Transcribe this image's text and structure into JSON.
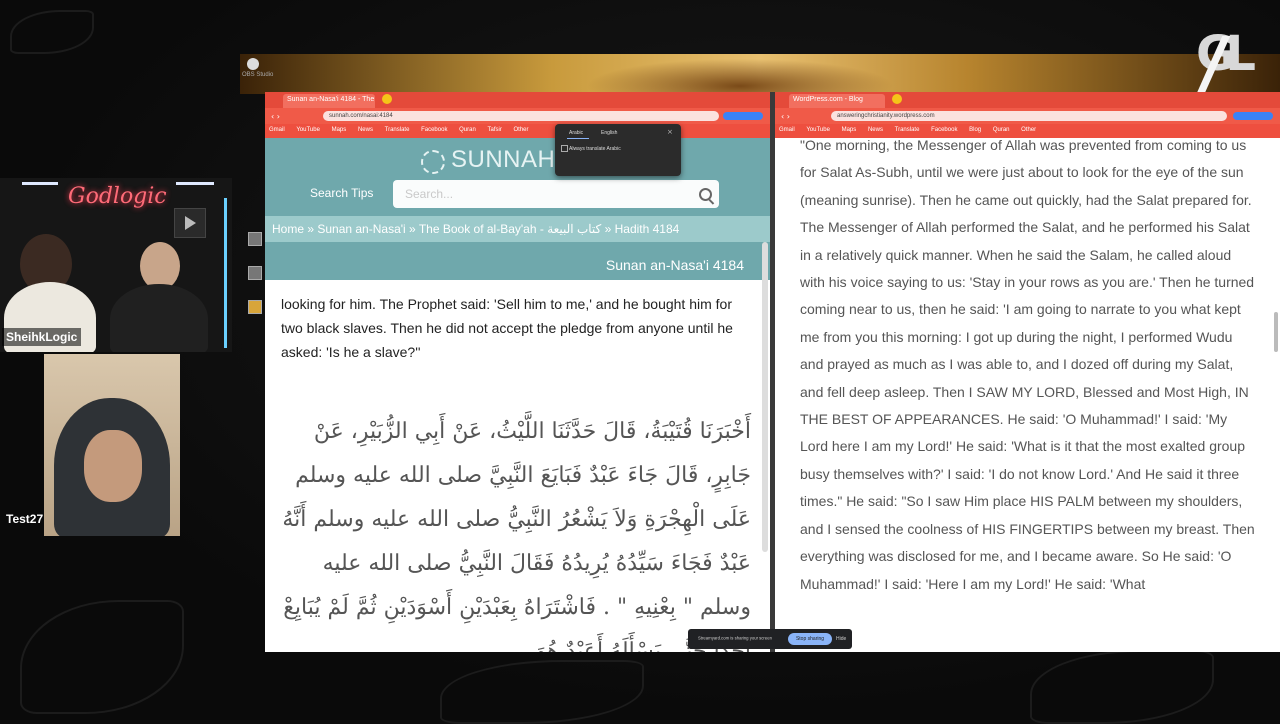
{
  "left_browser": {
    "tab_title": "Sunan an-Nasa'i 4184 - The Bo...",
    "url": "sunnah.com/nasai:4184",
    "bookmarks": [
      "Gmail",
      "YouTube",
      "Maps",
      "News",
      "Translate",
      "Facebook",
      "Quran",
      "Tafsir",
      "Other"
    ],
    "site_logo": "SUNNAH.C",
    "search_tips": "Search Tips",
    "search_placeholder": "Search...",
    "breadcrumb": "Home » Sunan an-Nasa'i » The Book of al-Bay'ah - كتاب البيعة » Hadith 4184",
    "collection_ref": "Sunan an-Nasa'i 4184",
    "english_text": "looking for him. The Prophet said: 'Sell him to me,' and he bought him for two black slaves. Then he did not accept the pledge from anyone until he asked: 'Is he a slave?''",
    "arabic_text": "أَخْبَرَنَا قُتَيْبَةُ، قَالَ حَدَّثَنَا اللَّيْثُ، عَنْ أَبِي الزُّبَيْرِ، عَنْ جَابِرٍ، قَالَ جَاءَ عَبْدٌ فَبَايَعَ النَّبِيَّ صلى الله عليه وسلم عَلَى الْهِجْرَةِ وَلاَ يَشْعُرُ النَّبِيُّ صلى الله عليه وسلم أَنَّهُ عَبْدٌ فَجَاءَ سَيِّدُهُ يُرِيدُهُ فَقَالَ النَّبِيُّ صلى الله عليه وسلم \" بِعْنِيهِ \" . فَاشْتَرَاهُ بِعَبْدَيْنِ أَسْوَدَيْنِ ثُمَّ لَمْ يُبَايِعْ أَحَدًا حَتَّى يَسْأَلَهُ أَعَبْدٌ هُوَ"
  },
  "translate_popup": {
    "lang_a": "Arabic",
    "lang_b": "English",
    "option": "Always translate Arabic"
  },
  "right_browser": {
    "tab_title": "WordPress.com - Blog",
    "url": "answeringchristianity.wordpress.com",
    "bookmarks": [
      "Gmail",
      "YouTube",
      "Maps",
      "News",
      "Translate",
      "Facebook",
      "Blog",
      "Quran",
      "Other"
    ],
    "article_text": "\"One morning, the Messenger of Allah was prevented from coming to us for Salat As-Subh, until we were just about to look for the eye of the sun (meaning sunrise). Then he came out quickly, had the Salat prepared for. The Messenger of Allah performed the Salat, and he performed his Salat in a relatively quick manner. When he said the Salam, he called aloud with his voice saying to us: 'Stay in your rows as you are.' Then he turned coming near to us, then he said: 'I am going to narrate to you what kept me from you this morning: I got up during the night, I performed Wudu and prayed as much as I was able to, and I dozed off during my Salat, and fell deep asleep. Then I SAW MY LORD, Blessed and Most High, IN THE BEST OF APPEARANCES. He said: 'O Muhammad!' I said: 'My Lord here I am my Lord!' He said: 'What is it that the most exalted group busy themselves with?' I said: 'I do not know Lord.' And He said it three times.\" He said: \"So I saw Him place HIS PALM between my shoulders, and I sensed the coolness of HIS FINGERTIPS between my breast. Then everything was disclosed for me, and I became aware. So He said: 'O Muhammad!' I said: 'Here I am my Lord!' He said: 'What"
  },
  "stream": {
    "neon_sign": "Godlogic",
    "cam1_name": "SheihkLogic",
    "cam2_name": "Test27",
    "logo": "GL",
    "obs_label": "OBS Studio"
  },
  "notification": {
    "text": "Streamyard.com is sharing your screen",
    "stop_button": "Stop sharing",
    "hide": "Hide"
  }
}
